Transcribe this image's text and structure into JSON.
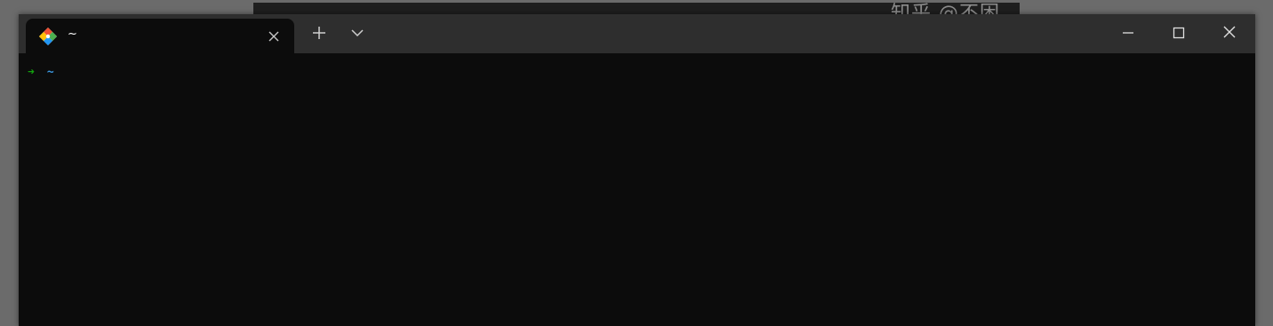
{
  "background": {
    "watermark": "知乎 @不困"
  },
  "window": {
    "tab": {
      "title": "~",
      "icon": "git-diamond-icon",
      "close_icon": "close-icon"
    },
    "toolbar": {
      "new_tab_icon": "plus-icon",
      "dropdown_icon": "chevron-down-icon"
    },
    "controls": {
      "minimize_icon": "minimize-icon",
      "maximize_icon": "maximize-icon",
      "close_icon": "close-icon"
    }
  },
  "terminal": {
    "prompt_arrow": "➜",
    "cwd": "~"
  },
  "colors": {
    "arrow": "#13a10e",
    "cwd": "#3a96dd",
    "titlebar": "#2e2e2e",
    "content": "#0c0c0c"
  }
}
